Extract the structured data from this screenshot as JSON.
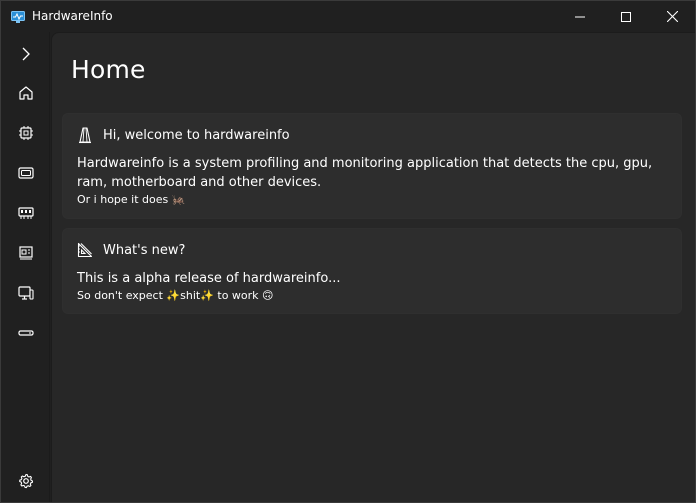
{
  "window": {
    "title": "HardwareInfo"
  },
  "nav": {
    "items": [
      {
        "name": "expand",
        "icon": "chevron-right-icon"
      },
      {
        "name": "home",
        "icon": "home-icon"
      },
      {
        "name": "cpu",
        "icon": "cpu-icon"
      },
      {
        "name": "gpu",
        "icon": "gpu-icon"
      },
      {
        "name": "ram",
        "icon": "ram-icon"
      },
      {
        "name": "motherboard",
        "icon": "motherboard-icon"
      },
      {
        "name": "devices",
        "icon": "devices-icon"
      },
      {
        "name": "storage",
        "icon": "storage-icon"
      },
      {
        "name": "settings",
        "icon": "gear-icon"
      }
    ]
  },
  "main": {
    "page_title": "Home",
    "cards": [
      {
        "icon": "beacon-icon",
        "title": "Hi, welcome to hardwareinfo",
        "body": "Hardwareinfo is a system profiling and monitoring application that detects the cpu, gpu, ram, motherboard and other devices.",
        "note": "Or i hope it does 🦗"
      },
      {
        "icon": "ruler-icon",
        "title": "What's new?",
        "body": "This is a alpha release of hardwareinfo...",
        "note": "So don't expect ✨shit✨ to work 🙃"
      }
    ]
  },
  "colors": {
    "background": "#202020",
    "content": "#272727",
    "card": "#2d2d2d",
    "text": "#ffffff"
  }
}
